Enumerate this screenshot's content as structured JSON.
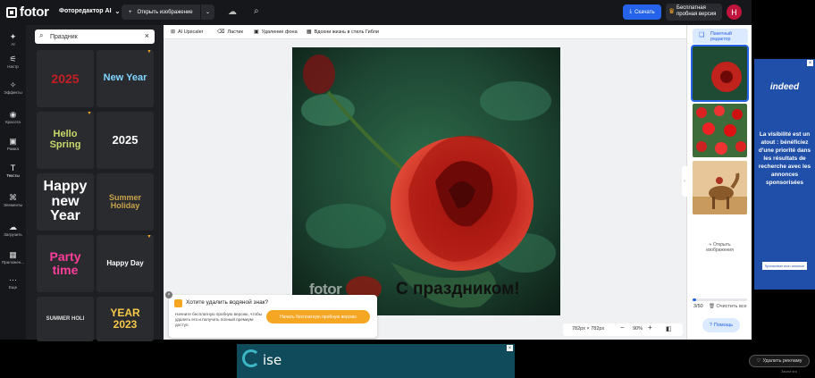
{
  "topbar": {
    "logo": "fotor",
    "product_label": "Фоторедактор AI",
    "open_image": "Открыть изображение",
    "save_label": "Скачать",
    "trial_line1": "Бесплатная",
    "trial_line2": "пробная версия",
    "avatar_letter": "H"
  },
  "leftnav": {
    "items": [
      {
        "label": "AI",
        "icon": "sparkle-icon"
      },
      {
        "label": "Настр",
        "icon": "sliders-icon"
      },
      {
        "label": "Эффекты",
        "icon": "wand-icon"
      },
      {
        "label": "Красота",
        "icon": "eye-icon"
      },
      {
        "label": "Рамка",
        "icon": "frame-icon"
      },
      {
        "label": "Тексты",
        "icon": "text-icon"
      },
      {
        "label": "Элементы",
        "icon": "shapes-icon"
      },
      {
        "label": "Загрузить",
        "icon": "cloud-upload-icon"
      },
      {
        "label": "Приложен...",
        "icon": "apps-icon"
      },
      {
        "label": "Еще",
        "icon": "more-icon"
      }
    ]
  },
  "panel": {
    "search_value": "Праздник",
    "tiles": [
      {
        "text": "2025",
        "color": "#c81d25"
      },
      {
        "text": "New Year",
        "color": "#7fd6ff"
      },
      {
        "text": "Hello Spring",
        "color": "#c9d86a"
      },
      {
        "text": "2025",
        "color": "#ffffff"
      },
      {
        "text": "Happy new Year",
        "color": "#ffffff"
      },
      {
        "text": "Summer Holiday",
        "color": "#c9a24a"
      },
      {
        "text": "Party time",
        "color": "#ff3d9a"
      },
      {
        "text": "Happy Day",
        "color": "#ffffff"
      },
      {
        "text": "SUMMER HOLI",
        "color": "#dddddd"
      },
      {
        "text": "YEAR 2023",
        "color": "#f7c948"
      }
    ]
  },
  "toolbar": {
    "upscaler": "AI Upscaler",
    "eraser": "Ластик",
    "remove_bg": "Удаление фона",
    "ghibli": "Вдохни жизнь в стиль Гибли"
  },
  "canvas": {
    "watermark": "fotor",
    "caption": "С праздником!"
  },
  "promo": {
    "title": "Хотите удалить водяной знак?",
    "text": "Начните бесплатную пробную версию, чтобы удалить его и получить полный премиум-доступ.",
    "button": "Начать бесплатную пробную версию"
  },
  "zoombar": {
    "size": "782px × 782px",
    "zoom": "90%"
  },
  "rightpanel": {
    "batch_line1": "Пакетный",
    "batch_line2": "редактор",
    "add_line1": "Открыть",
    "add_line2": "изображения",
    "count": "3/50",
    "progress": 0.06,
    "clear_all": "Очистить все",
    "help": "Помощь"
  },
  "ad_right": {
    "brand": "indeed",
    "copy": "La visibilité est un atout : bénéficiez d'une priorité dans les résultats de recherche avec les annonces sponsorisées",
    "cta": "Sponsoriser mon annonce"
  },
  "ad_bottom": {
    "brand": "ise"
  },
  "bottom": {
    "remove_ads": "Удалить рекламу",
    "why": "Зачем эта"
  },
  "colors": {
    "accent": "#2563eb",
    "trial_orange": "#f5a623",
    "dark_bg": "#16171b"
  }
}
